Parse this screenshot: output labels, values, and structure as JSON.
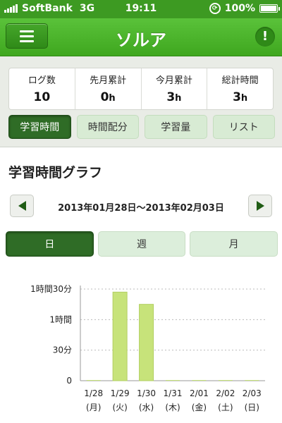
{
  "status_bar": {
    "carrier": "SoftBank",
    "network": "3G",
    "time": "19:11",
    "battery": "100%"
  },
  "nav": {
    "title": "ソルア"
  },
  "stats": [
    {
      "label": "ログ数",
      "value": "10",
      "unit": ""
    },
    {
      "label": "先月累計",
      "value": "0",
      "unit": "h"
    },
    {
      "label": "今月累計",
      "value": "3",
      "unit": "h"
    },
    {
      "label": "総計時間",
      "value": "3",
      "unit": "h"
    }
  ],
  "tabs": [
    {
      "label": "学習時間",
      "active": true
    },
    {
      "label": "時間配分",
      "active": false
    },
    {
      "label": "学習量",
      "active": false
    },
    {
      "label": "リスト",
      "active": false
    }
  ],
  "section_title": "学習時間グラフ",
  "date_range": "2013年01月28日〜2013年02月03日",
  "period_tabs": [
    {
      "label": "日",
      "active": true
    },
    {
      "label": "週",
      "active": false
    },
    {
      "label": "月",
      "active": false
    }
  ],
  "colors": {
    "bar": "#c7e37a",
    "accent": "#3fa71f",
    "active_tab": "#2f6c26"
  },
  "chart_data": {
    "type": "bar",
    "categories": [
      "1/28",
      "1/29",
      "1/30",
      "1/31",
      "2/01",
      "2/02",
      "2/03"
    ],
    "weekdays": [
      "(月)",
      "(火)",
      "(水)",
      "(木)",
      "(金)",
      "(土)",
      "(日)"
    ],
    "values": [
      0,
      87,
      75,
      0,
      0,
      0,
      0
    ],
    "yticks": [
      {
        "value": 0,
        "label": "0"
      },
      {
        "value": 30,
        "label": "30分"
      },
      {
        "value": 60,
        "label": "1時間"
      },
      {
        "value": 90,
        "label": "1時間30分"
      }
    ],
    "ylim": [
      0,
      90
    ],
    "grid": true
  }
}
